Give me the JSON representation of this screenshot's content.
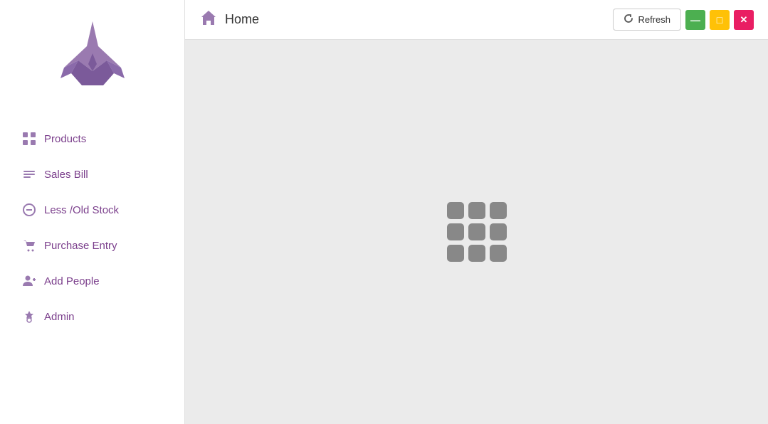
{
  "header": {
    "title": "Home",
    "refresh_label": "Refresh"
  },
  "sidebar": {
    "nav_items": [
      {
        "id": "products",
        "label": "Products"
      },
      {
        "id": "sales-bill",
        "label": "Sales Bill"
      },
      {
        "id": "less-old-stock",
        "label": "Less /Old Stock"
      },
      {
        "id": "purchase-entry",
        "label": "Purchase Entry"
      },
      {
        "id": "add-people",
        "label": "Add People"
      },
      {
        "id": "admin",
        "label": "Admin"
      }
    ]
  },
  "window_controls": {
    "minimize": "—",
    "maximize": "□",
    "close": "✕"
  }
}
